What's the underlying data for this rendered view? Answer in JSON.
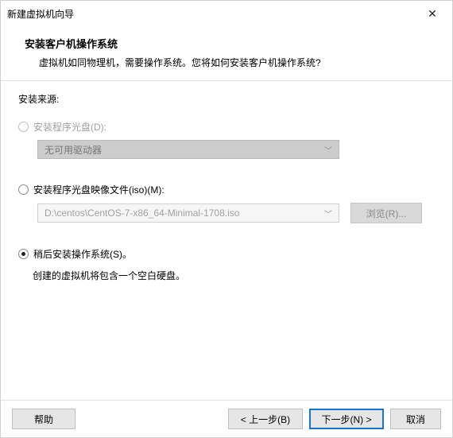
{
  "titlebar": {
    "title": "新建虚拟机向导",
    "close": "✕"
  },
  "header": {
    "title": "安装客户机操作系统",
    "subtitle": "虚拟机如同物理机，需要操作系统。您将如何安装客户机操作系统?"
  },
  "source_label": "安装来源:",
  "option_disc": {
    "label": "安装程序光盘(D):",
    "dropdown": "无可用驱动器"
  },
  "option_iso": {
    "label": "安装程序光盘映像文件(iso)(M):",
    "path": "D:\\centos\\CentOS-7-x86_64-Minimal-1708.iso",
    "browse": "浏览(R)..."
  },
  "option_later": {
    "label": "稍后安装操作系统(S)。",
    "note": "创建的虚拟机将包含一个空白硬盘。"
  },
  "footer": {
    "help": "帮助",
    "back": "< 上一步(B)",
    "next": "下一步(N) >",
    "cancel": "取消"
  }
}
